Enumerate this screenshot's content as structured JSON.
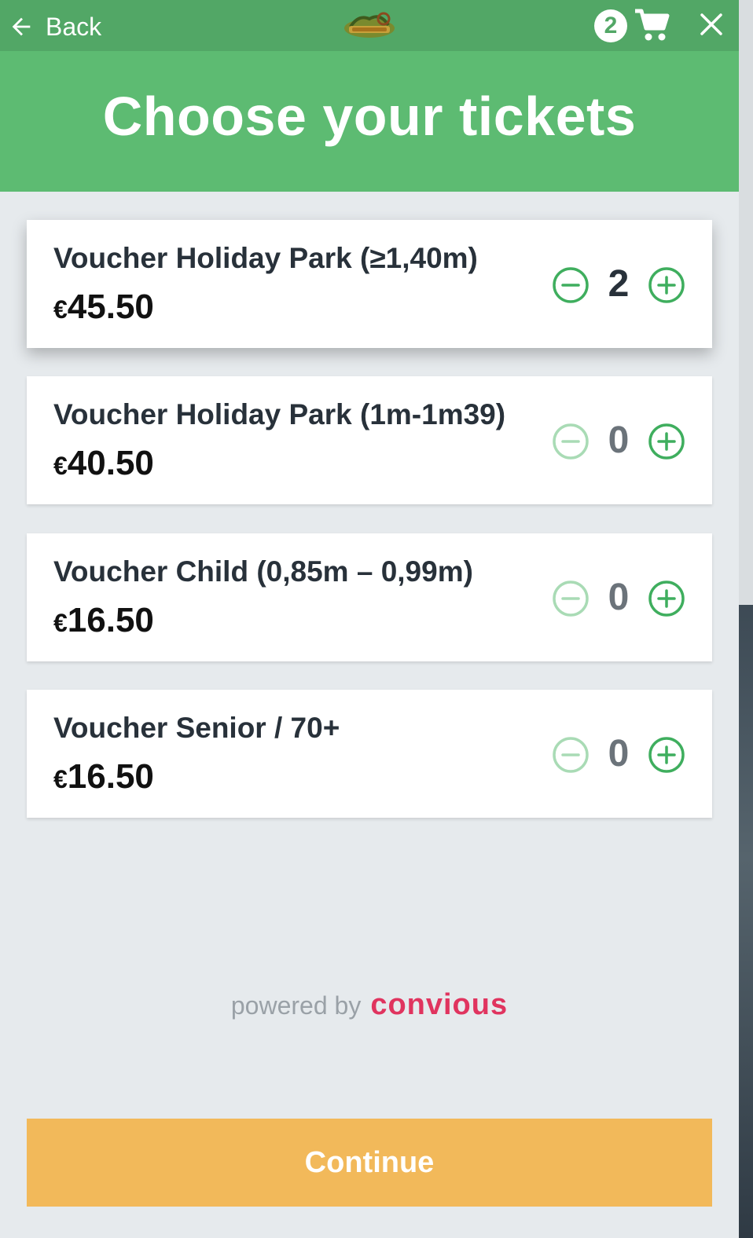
{
  "topbar": {
    "back_label": "Back",
    "logo_icon": "holiday-park-logo",
    "cart_count": "2",
    "cart_icon": "shopping-cart-icon",
    "close_icon": "close-icon"
  },
  "header": {
    "title": "Choose your tickets"
  },
  "tickets": [
    {
      "name": "Voucher Holiday Park (≥1,40m)",
      "currency": "€",
      "price": "45.50",
      "quantity": "2"
    },
    {
      "name": "Voucher Holiday Park (1m-1m39)",
      "currency": "€",
      "price": "40.50",
      "quantity": "0"
    },
    {
      "name": "Voucher Child (0,85m – 0,99m)",
      "currency": "€",
      "price": "16.50",
      "quantity": "0"
    },
    {
      "name": "Voucher Senior / 70+",
      "currency": "€",
      "price": "16.50",
      "quantity": "0"
    }
  ],
  "footer": {
    "powered_by": "powered by",
    "brand": "convious",
    "continue_label": "Continue"
  },
  "colors": {
    "topbar": "#52a766",
    "header": "#5dbb72",
    "accent_green": "#3fae5e",
    "continue": "#f2b95a",
    "brand": "#e0345f"
  }
}
